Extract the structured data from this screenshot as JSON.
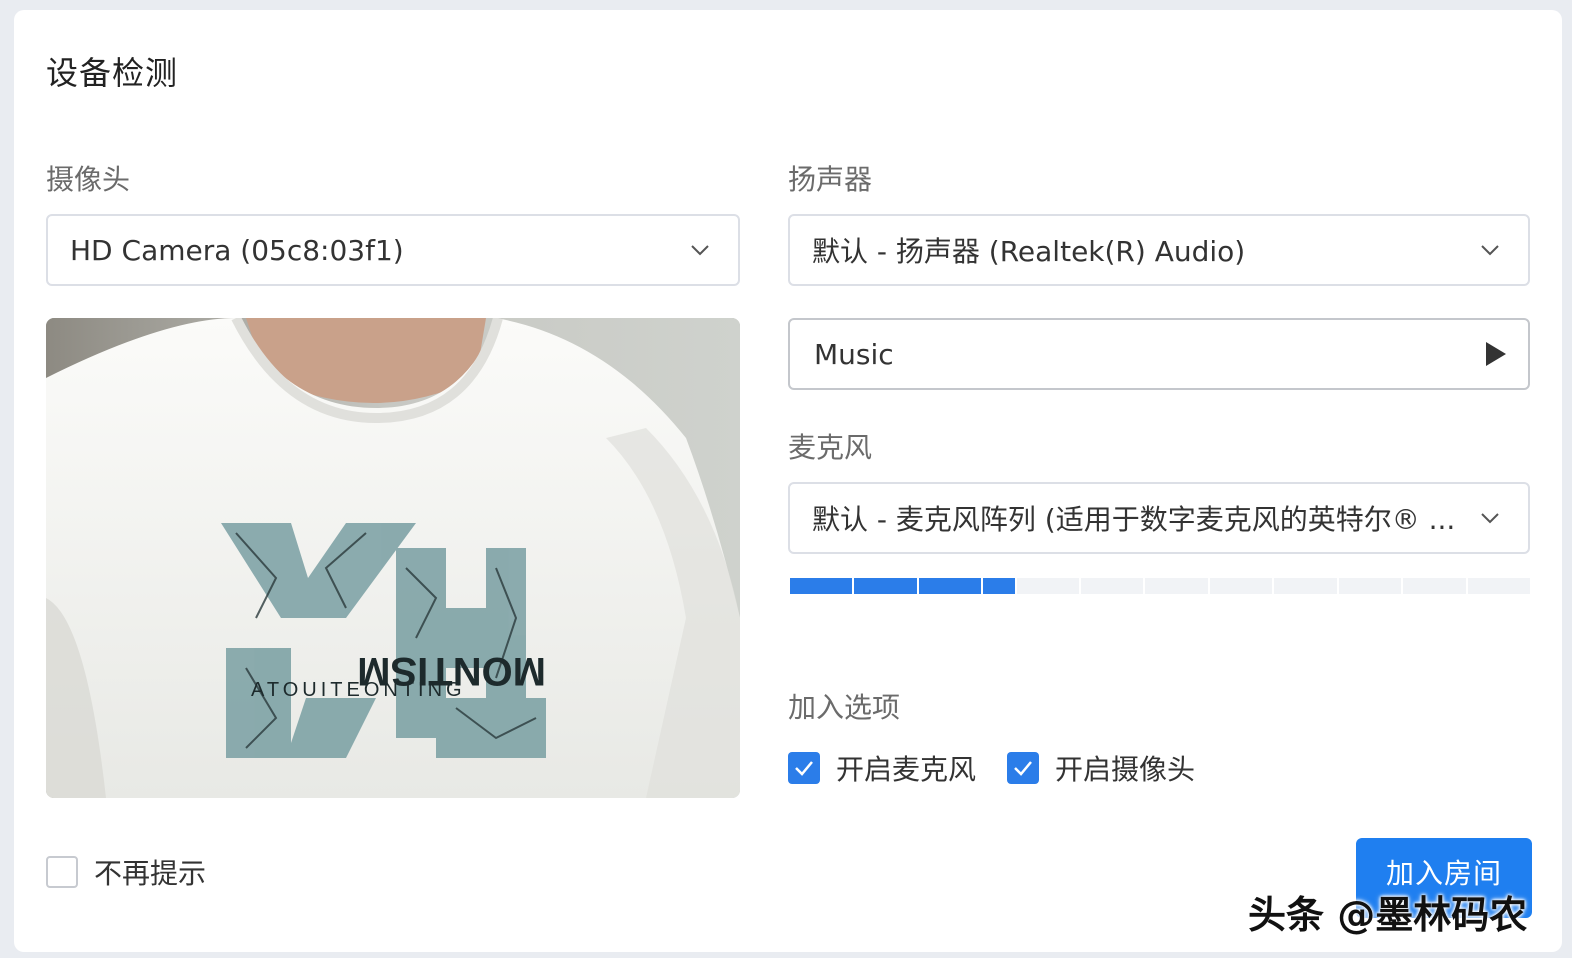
{
  "dialog": {
    "title": "设备检测"
  },
  "camera": {
    "label": "摄像头",
    "selected": "HD Camera (05c8:03f1)",
    "preview": {
      "shirt_text_1": "MONTISM",
      "shirt_text_2": "ATOUITEONTING"
    }
  },
  "speaker": {
    "label": "扬声器",
    "selected": "默认 - 扬声器 (Realtek(R) Audio)",
    "test_audio": "Music"
  },
  "microphone": {
    "label": "麦克风",
    "selected": "默认 - 麦克风阵列 (适用于数字麦克风的英特尔® ...",
    "level": {
      "active_segments": 4,
      "total_segments": 12
    }
  },
  "join_options": {
    "label": "加入选项",
    "enable_mic": {
      "label": "开启麦克风",
      "checked": true
    },
    "enable_camera": {
      "label": "开启摄像头",
      "checked": true
    }
  },
  "dont_show_again": {
    "label": "不再提示",
    "checked": false
  },
  "join_button": {
    "label": "加入房间"
  },
  "watermark": {
    "text": "头条 @墨林码农"
  },
  "colors": {
    "accent": "#2b7de9",
    "button": "#1f7ff0",
    "border": "#dcdfe6"
  }
}
